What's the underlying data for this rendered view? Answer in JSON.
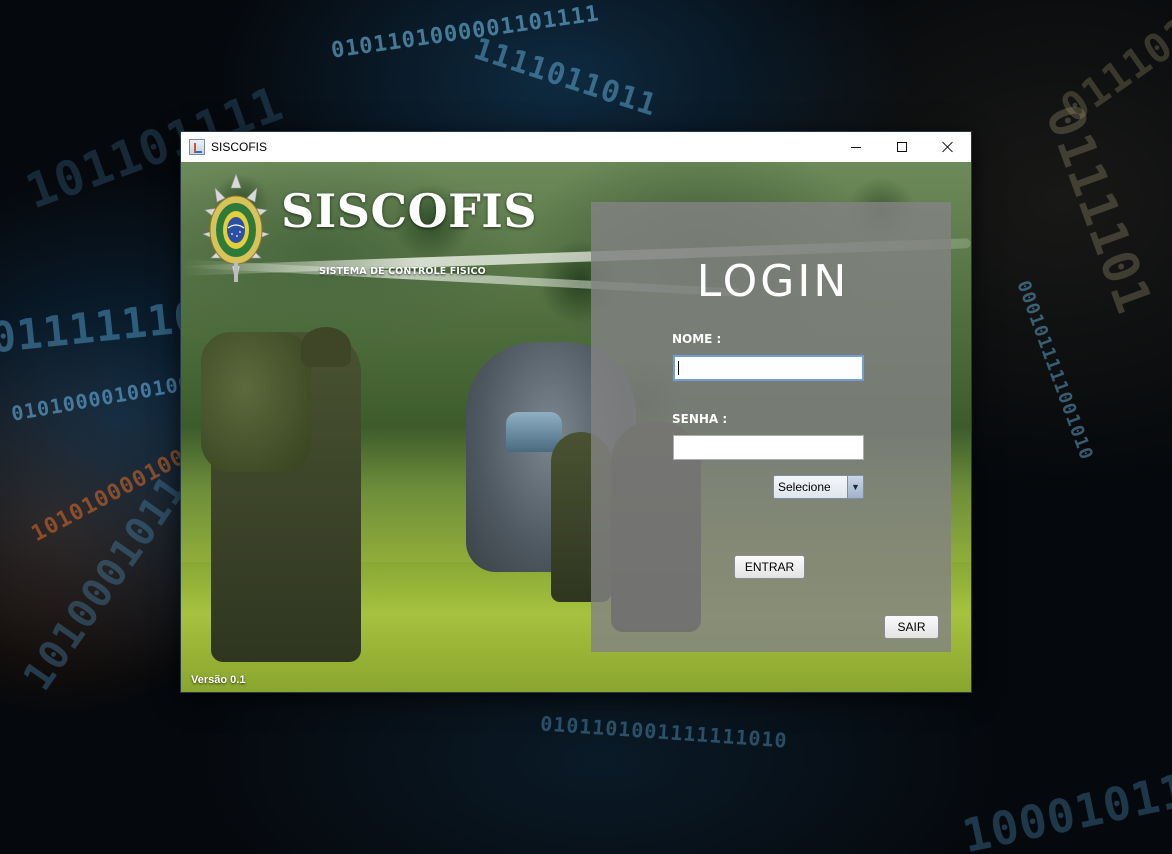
{
  "window": {
    "title": "SISCOFIS"
  },
  "brand": {
    "title": "SISCOFIS",
    "subtitle": "SISTEMA DE CONTROLE FISICO",
    "version": "Versão 0.1"
  },
  "login": {
    "heading": "LOGIN",
    "name_label": "NOME :",
    "name_value": "",
    "password_label": "SENHA :",
    "password_value": "",
    "select_value": "Selecione",
    "enter_button": "ENTRAR",
    "exit_button": "SAIR"
  },
  "icons": {
    "app": "java-app-icon",
    "minimize": "minimize-icon",
    "maximize": "maximize-icon",
    "close": "close-icon",
    "dropdown": "chevron-down-icon",
    "emblem": "army-emblem-icon"
  }
}
